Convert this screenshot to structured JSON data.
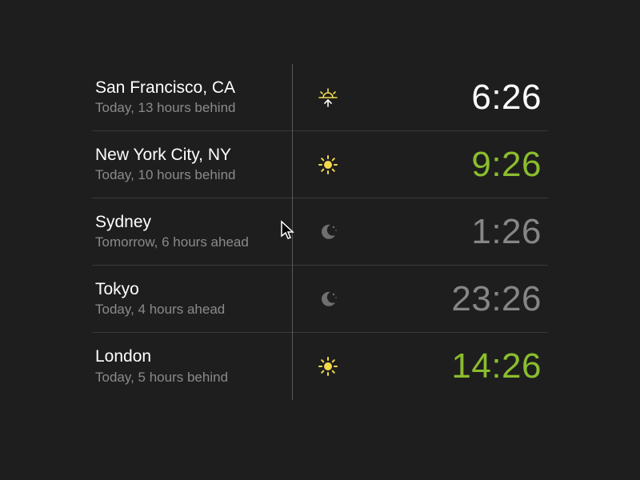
{
  "colors": {
    "background": "#1e1e1e",
    "text_primary": "#ffffff",
    "text_secondary": "#8a8a8a",
    "accent_green": "#8bbd2e",
    "dim_gray": "#868686",
    "sun_yellow": "#f2d94e"
  },
  "clocks": [
    {
      "city": "San Francisco, CA",
      "offset": "Today, 13 hours behind",
      "time": "6:26",
      "icon": "sunrise-icon",
      "time_color": "white"
    },
    {
      "city": "New York City, NY",
      "offset": "Today, 10 hours behind",
      "time": "9:26",
      "icon": "sun-icon",
      "time_color": "green"
    },
    {
      "city": "Sydney",
      "offset": "Tomorrow, 6 hours ahead",
      "time": "1:26",
      "icon": "moon-icon",
      "time_color": "gray"
    },
    {
      "city": "Tokyo",
      "offset": "Today, 4 hours ahead",
      "time": "23:26",
      "icon": "moon-icon",
      "time_color": "gray"
    },
    {
      "city": "London",
      "offset": "Today, 5 hours behind",
      "time": "14:26",
      "icon": "sun-icon",
      "time_color": "green"
    }
  ]
}
